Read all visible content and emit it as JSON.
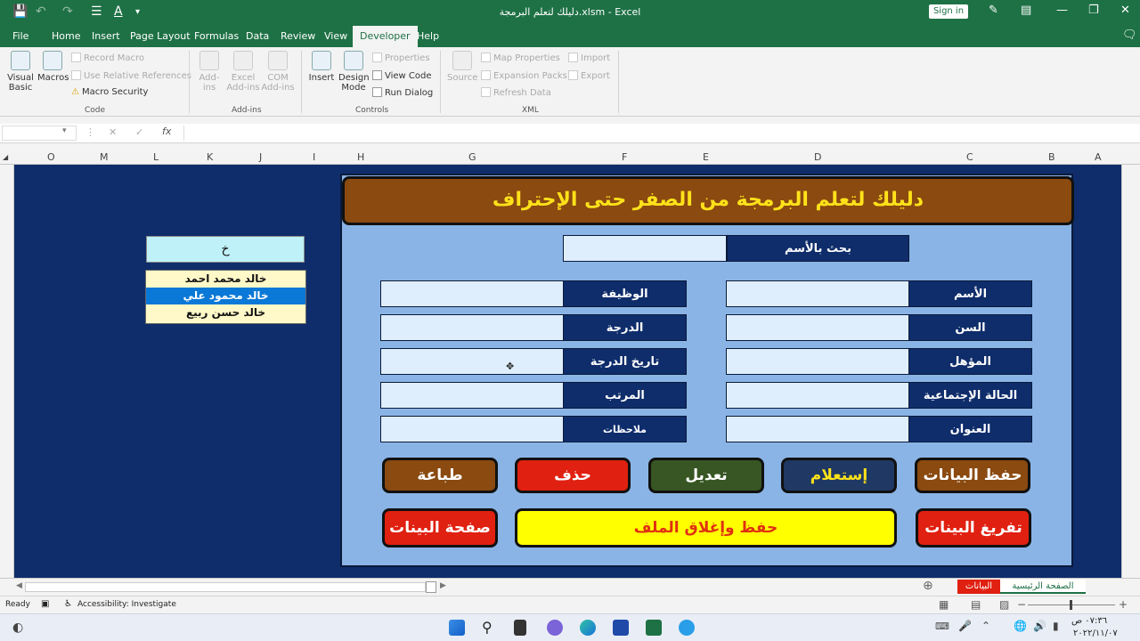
{
  "window": {
    "title": "دليلك لتعلم البرمجة.xlsm  -  Excel",
    "signin": "Sign in"
  },
  "tabs": [
    "File",
    "Home",
    "Insert",
    "Page Layout",
    "Formulas",
    "Data",
    "Review",
    "View",
    "Developer",
    "Help"
  ],
  "active_tab": "Developer",
  "ribbon": {
    "code": {
      "visual_basic": "Visual Basic",
      "macros": "Macros",
      "record_macro": "Record Macro",
      "relative_refs": "Use Relative References",
      "macro_security": "Macro Security",
      "label": "Code"
    },
    "addins": {
      "addins": "Add-ins",
      "excel_addins": "Excel Add-ins",
      "com_addins": "COM Add-ins",
      "label": "Add-ins"
    },
    "controls": {
      "insert": "Insert",
      "design_mode": "Design Mode",
      "properties": "Properties",
      "view_code": "View Code",
      "run_dialog": "Run Dialog",
      "label": "Controls"
    },
    "xml": {
      "source": "Source",
      "map_properties": "Map Properties",
      "expansion_packs": "Expansion Packs",
      "refresh_data": "Refresh Data",
      "import": "Import",
      "export": "Export",
      "label": "XML"
    }
  },
  "formula_bar": {
    "fx": "fx",
    "name_box": "",
    "value": ""
  },
  "columns": [
    "O",
    "M",
    "L",
    "K",
    "J",
    "I",
    "H",
    "G",
    "F",
    "E",
    "D",
    "C",
    "B",
    "A"
  ],
  "form": {
    "title": "دليلك لتعلم البرمجة من الصفر حتى الإحتراف",
    "search_label": "بحث بالأسم",
    "right_labels": [
      "الأسم",
      "السن",
      "المؤهل",
      "الحالة الإجتماعية",
      "العنوان"
    ],
    "left_labels": [
      "الوظيفة",
      "الدرجة",
      "تاريخ الدرجة",
      "المرتب",
      "ملاحظات"
    ],
    "buttons_row1": [
      "حفظ البيانات",
      "إستعلام",
      "تعديل",
      "حذف",
      "طباعة"
    ],
    "btn_clear": "تفريغ البينات",
    "btn_save_close": "حفظ وإغلاق الملف",
    "btn_data_page": "صفحة البينات"
  },
  "list": {
    "header": "خ",
    "items": [
      "خالد محمد احمد",
      "خالد محمود علي",
      "خالد حسن ربيع"
    ],
    "selected_index": 1
  },
  "sheet_tabs": [
    "الصفحة الرئيسية",
    "البيانات"
  ],
  "status": {
    "ready": "Ready",
    "accessibility": "Accessibility: Investigate"
  },
  "clock": {
    "time": "٠٧:٣٦ ص",
    "date": "٢٠٢٢/١١/٠٧"
  },
  "colors": {
    "excel_green": "#1e7145",
    "navy": "#0f2d6b",
    "form_bg": "#8ab4e6"
  }
}
